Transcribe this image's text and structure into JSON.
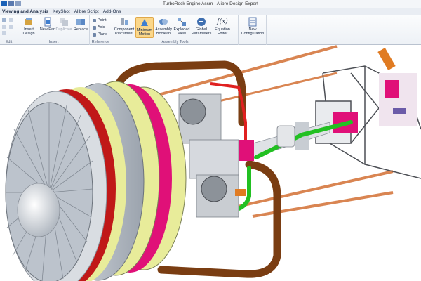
{
  "window": {
    "title": "TurboRock Engine Assm - Alibre Design Expert"
  },
  "menu_tabs": [
    {
      "label": "Viewing and Analysis"
    },
    {
      "label": "KeyShot"
    },
    {
      "label": "Alibre Script"
    },
    {
      "label": "Add-Ons"
    }
  ],
  "ribbon": {
    "groups": {
      "edit": "Edit",
      "insert": "Insert",
      "reference": "Reference",
      "assembly_tools": "Assembly Tools"
    },
    "buttons": {
      "insert_design": "Insert Design",
      "new_part": "New Part",
      "duplicate": "Duplicate",
      "replace": "Replace",
      "point": "Point",
      "axis": "Axis",
      "plane": "Plane",
      "component_placement": "Component Placement",
      "minimum_motion": "Minimum Motion",
      "assembly_boolean": "Assembly Boolean",
      "exploded_view": "Exploded View",
      "global_parameters": "Global Parameters",
      "equation_editor": "Equation Editor",
      "equation_glyph": "f(x)",
      "new_configuration": "New Configuration"
    }
  },
  "colors": {
    "pipe_brown": "#7a3d12",
    "ring_red": "#c01818",
    "ring_magenta": "#e01078",
    "ring_cream": "#e8ec9a",
    "fan_gray": "#bcc3cc",
    "line_green": "#22c022",
    "line_red": "#e02020",
    "rod_copper": "#d98552",
    "ribbon_active": "#fbd78a"
  }
}
